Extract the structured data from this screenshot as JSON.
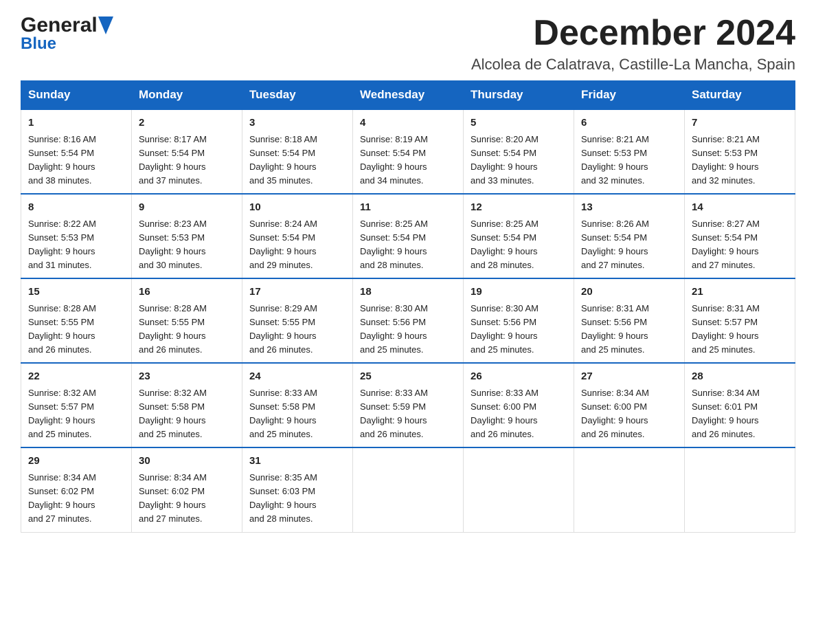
{
  "header": {
    "logo_general": "General",
    "logo_blue": "Blue",
    "month_title": "December 2024",
    "location": "Alcolea de Calatrava, Castille-La Mancha, Spain"
  },
  "days_of_week": [
    "Sunday",
    "Monday",
    "Tuesday",
    "Wednesday",
    "Thursday",
    "Friday",
    "Saturday"
  ],
  "weeks": [
    [
      {
        "day": "1",
        "sunrise": "8:16 AM",
        "sunset": "5:54 PM",
        "daylight": "9 hours and 38 minutes."
      },
      {
        "day": "2",
        "sunrise": "8:17 AM",
        "sunset": "5:54 PM",
        "daylight": "9 hours and 37 minutes."
      },
      {
        "day": "3",
        "sunrise": "8:18 AM",
        "sunset": "5:54 PM",
        "daylight": "9 hours and 35 minutes."
      },
      {
        "day": "4",
        "sunrise": "8:19 AM",
        "sunset": "5:54 PM",
        "daylight": "9 hours and 34 minutes."
      },
      {
        "day": "5",
        "sunrise": "8:20 AM",
        "sunset": "5:54 PM",
        "daylight": "9 hours and 33 minutes."
      },
      {
        "day": "6",
        "sunrise": "8:21 AM",
        "sunset": "5:53 PM",
        "daylight": "9 hours and 32 minutes."
      },
      {
        "day": "7",
        "sunrise": "8:21 AM",
        "sunset": "5:53 PM",
        "daylight": "9 hours and 32 minutes."
      }
    ],
    [
      {
        "day": "8",
        "sunrise": "8:22 AM",
        "sunset": "5:53 PM",
        "daylight": "9 hours and 31 minutes."
      },
      {
        "day": "9",
        "sunrise": "8:23 AM",
        "sunset": "5:53 PM",
        "daylight": "9 hours and 30 minutes."
      },
      {
        "day": "10",
        "sunrise": "8:24 AM",
        "sunset": "5:54 PM",
        "daylight": "9 hours and 29 minutes."
      },
      {
        "day": "11",
        "sunrise": "8:25 AM",
        "sunset": "5:54 PM",
        "daylight": "9 hours and 28 minutes."
      },
      {
        "day": "12",
        "sunrise": "8:25 AM",
        "sunset": "5:54 PM",
        "daylight": "9 hours and 28 minutes."
      },
      {
        "day": "13",
        "sunrise": "8:26 AM",
        "sunset": "5:54 PM",
        "daylight": "9 hours and 27 minutes."
      },
      {
        "day": "14",
        "sunrise": "8:27 AM",
        "sunset": "5:54 PM",
        "daylight": "9 hours and 27 minutes."
      }
    ],
    [
      {
        "day": "15",
        "sunrise": "8:28 AM",
        "sunset": "5:55 PM",
        "daylight": "9 hours and 26 minutes."
      },
      {
        "day": "16",
        "sunrise": "8:28 AM",
        "sunset": "5:55 PM",
        "daylight": "9 hours and 26 minutes."
      },
      {
        "day": "17",
        "sunrise": "8:29 AM",
        "sunset": "5:55 PM",
        "daylight": "9 hours and 26 minutes."
      },
      {
        "day": "18",
        "sunrise": "8:30 AM",
        "sunset": "5:56 PM",
        "daylight": "9 hours and 25 minutes."
      },
      {
        "day": "19",
        "sunrise": "8:30 AM",
        "sunset": "5:56 PM",
        "daylight": "9 hours and 25 minutes."
      },
      {
        "day": "20",
        "sunrise": "8:31 AM",
        "sunset": "5:56 PM",
        "daylight": "9 hours and 25 minutes."
      },
      {
        "day": "21",
        "sunrise": "8:31 AM",
        "sunset": "5:57 PM",
        "daylight": "9 hours and 25 minutes."
      }
    ],
    [
      {
        "day": "22",
        "sunrise": "8:32 AM",
        "sunset": "5:57 PM",
        "daylight": "9 hours and 25 minutes."
      },
      {
        "day": "23",
        "sunrise": "8:32 AM",
        "sunset": "5:58 PM",
        "daylight": "9 hours and 25 minutes."
      },
      {
        "day": "24",
        "sunrise": "8:33 AM",
        "sunset": "5:58 PM",
        "daylight": "9 hours and 25 minutes."
      },
      {
        "day": "25",
        "sunrise": "8:33 AM",
        "sunset": "5:59 PM",
        "daylight": "9 hours and 26 minutes."
      },
      {
        "day": "26",
        "sunrise": "8:33 AM",
        "sunset": "6:00 PM",
        "daylight": "9 hours and 26 minutes."
      },
      {
        "day": "27",
        "sunrise": "8:34 AM",
        "sunset": "6:00 PM",
        "daylight": "9 hours and 26 minutes."
      },
      {
        "day": "28",
        "sunrise": "8:34 AM",
        "sunset": "6:01 PM",
        "daylight": "9 hours and 26 minutes."
      }
    ],
    [
      {
        "day": "29",
        "sunrise": "8:34 AM",
        "sunset": "6:02 PM",
        "daylight": "9 hours and 27 minutes."
      },
      {
        "day": "30",
        "sunrise": "8:34 AM",
        "sunset": "6:02 PM",
        "daylight": "9 hours and 27 minutes."
      },
      {
        "day": "31",
        "sunrise": "8:35 AM",
        "sunset": "6:03 PM",
        "daylight": "9 hours and 28 minutes."
      },
      null,
      null,
      null,
      null
    ]
  ]
}
